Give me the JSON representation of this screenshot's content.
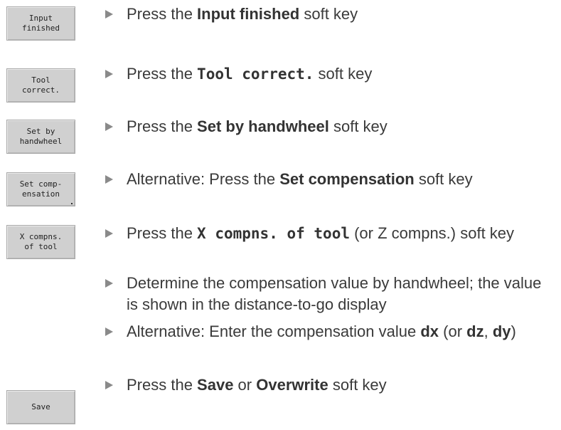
{
  "softkeys": {
    "input_finished": "Input\nfinished",
    "tool_correct": "Tool\ncorrect.",
    "set_by_handwheel": "Set by\nhandwheel",
    "set_compensation": "Set comp-\nensation",
    "x_compns": "X compns.\nof tool",
    "save": "Save"
  },
  "steps": {
    "s1": {
      "pre": "Press the ",
      "bold": "Input finished",
      "post": " soft key"
    },
    "s2": {
      "pre": "Press the ",
      "bold": "Tool correct.",
      "post": " soft key"
    },
    "s3": {
      "pre": "Press the ",
      "bold": "Set by handwheel",
      "post": " soft key"
    },
    "s4": {
      "pre": "Alternative: Press the ",
      "bold": "Set compensation",
      "post": " soft key"
    },
    "s5": {
      "pre": "Press the ",
      "bold": "X compns. of tool",
      "post": " (or Z compns.) soft key"
    },
    "s6": {
      "text": "Determine the compensation value by handwheel; the value is shown in the distance-to-go display"
    },
    "s7": {
      "pre": "Alternative: Enter the compensation value ",
      "b1": "dx",
      "mid1": " (or ",
      "b2": "dz",
      "mid2": ", ",
      "b3": "dy",
      "post": ")"
    },
    "s8": {
      "pre": "Press the ",
      "b1": "Save",
      "mid": " or ",
      "b2": "Overwrite",
      "post": " soft key"
    }
  }
}
